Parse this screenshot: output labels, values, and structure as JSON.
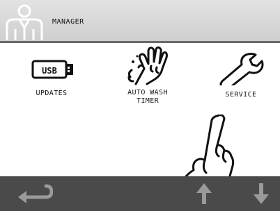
{
  "header": {
    "title": "MANAGER",
    "icon": "manager-user-icon"
  },
  "menu": {
    "items": [
      {
        "label": "UPDATES",
        "icon": "usb-icon"
      },
      {
        "label": "AUTO WASH\nTIMER",
        "icon": "hand-wash-icon"
      },
      {
        "label": "SERVICE",
        "icon": "wrench-icon"
      }
    ]
  },
  "overlay": {
    "icon": "pointing-hand-icon"
  },
  "footer": {
    "back_icon": "back-arrow-icon",
    "up_icon": "up-arrow-icon",
    "down_icon": "down-arrow-icon"
  },
  "colors": {
    "header_bg": "#d8d8d8",
    "footer_bg": "#4a4a4a",
    "footer_icon": "#9a9a9a"
  }
}
